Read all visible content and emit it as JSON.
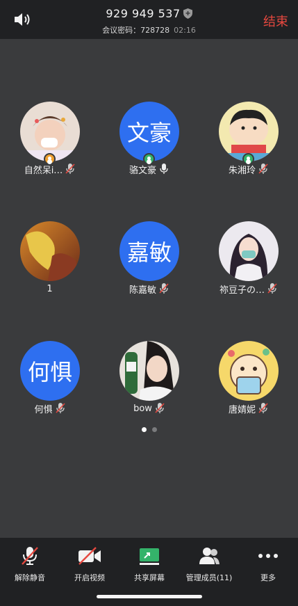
{
  "header": {
    "meeting_id": "929 949 537",
    "passcode_label": "会议密码：728728",
    "timer": "02:16",
    "end_label": "结束"
  },
  "participants": [
    {
      "name": "自然呆i…",
      "avatar_type": "photo",
      "avatar_text": "",
      "host_badge": true,
      "badge_color": "#f0a030",
      "muted": true
    },
    {
      "name": "骆文豪",
      "avatar_type": "text",
      "avatar_text": "文豪",
      "host_badge": true,
      "badge_color": "#34b36a",
      "muted": false
    },
    {
      "name": "朱湘玲",
      "avatar_type": "photo",
      "avatar_text": "",
      "host_badge": true,
      "badge_color": "#34b36a",
      "muted": true
    },
    {
      "name": "1",
      "avatar_type": "photo",
      "avatar_text": "",
      "host_badge": false,
      "muted": false
    },
    {
      "name": "陈嘉敏",
      "avatar_type": "text",
      "avatar_text": "嘉敏",
      "host_badge": false,
      "muted": true
    },
    {
      "name": "祢豆子の…",
      "avatar_type": "photo",
      "avatar_text": "",
      "host_badge": false,
      "muted": true
    },
    {
      "name": "何惧",
      "avatar_type": "text",
      "avatar_text": "何惧",
      "host_badge": false,
      "muted": true
    },
    {
      "name": "bow",
      "avatar_type": "photo",
      "avatar_text": "",
      "host_badge": false,
      "muted": true
    },
    {
      "name": "唐婧妮",
      "avatar_type": "photo",
      "avatar_text": "",
      "host_badge": false,
      "muted": true
    }
  ],
  "pagination": {
    "pages": 2,
    "current": 1
  },
  "toolbar": {
    "unmute_label": "解除静音",
    "video_label": "开启视频",
    "share_label": "共享屏幕",
    "members_label": "管理成员(11)",
    "more_label": "更多"
  },
  "colors": {
    "accent_blue": "#2e6ff0",
    "end_red": "#e5483f",
    "share_green": "#34b36a",
    "muted_red": "#e5483f"
  }
}
